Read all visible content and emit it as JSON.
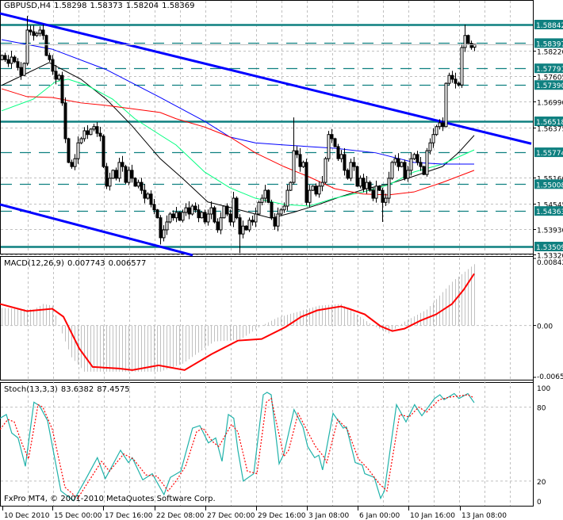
{
  "header": {
    "symbol": "GBPUSD,H4",
    "open": "1.58298",
    "high": "1.58373",
    "low": "1.58204",
    "close": "1.58369"
  },
  "copyright": "FxPro MT4, © 2001-2010 MetaQuotes Software Corp.",
  "colors": {
    "level": "#0f8080",
    "trend": "#0000ff",
    "ma_fast": "#000000",
    "ma_mid": "#00ff7f",
    "ma_slow": "#0000ff",
    "ma_long": "#ff0000",
    "macd_hist": "#c0c0c0",
    "macd_signal": "#ff0000",
    "stoch_main": "#20b2aa",
    "stoch_signal": "#ff0000",
    "grid": "#c0c0c0"
  },
  "chart_data": {
    "type": "candlestick",
    "title": "GBPUSD,H4",
    "price_axis_labels": [
      "1.58220",
      "1.57605",
      "1.56990",
      "1.56375",
      "1.55160",
      "1.54545",
      "1.53930",
      "1.53320"
    ],
    "levels": [
      {
        "label": "1.58842",
        "style": "solid"
      },
      {
        "label": "1.58397",
        "style": "dashed"
      },
      {
        "label": "1.57791",
        "style": "dashed"
      },
      {
        "label": "1.57390",
        "style": "dashed"
      },
      {
        "label": "1.56518",
        "style": "solid"
      },
      {
        "label": "1.55774",
        "style": "dashed"
      },
      {
        "label": "1.55008",
        "style": "dashed"
      },
      {
        "label": "1.54363",
        "style": "dashed"
      },
      {
        "label": "1.53509",
        "style": "solid"
      }
    ],
    "bid": 1.58369,
    "time_labels": [
      {
        "text": "10 Dec 2010",
        "bar": 0.25
      },
      {
        "text": "15 Dec 00:00",
        "bar": 16
      },
      {
        "text": "17 Dec 16:00",
        "bar": 32
      },
      {
        "text": "22 Dec 08:00",
        "bar": 48.25
      },
      {
        "text": "27 Dec 00:00",
        "bar": 64.25
      },
      {
        "text": "29 Dec 16:00",
        "bar": 80.25
      },
      {
        "text": "3 Jan 08:00",
        "bar": 96.25
      },
      {
        "text": "6 Jan 00:00",
        "bar": 112.25
      },
      {
        "text": "10 Jan 16:00",
        "bar": 128.25
      },
      {
        "text": "13 Jan 08:00",
        "bar": 144.5
      }
    ],
    "first_open": 1.58,
    "last_bar": {
      "open": 1.58298,
      "high": 1.58373,
      "low": 1.58204,
      "close": 1.58369
    },
    "high_overrides": {
      "8": 1.5905,
      "92": 1.5661,
      "146": 1.5884
    },
    "low_overrides": {
      "75": 1.5335,
      "50": 1.5356,
      "120": 1.541
    },
    "close": [
      1.581,
      1.58,
      1.5791,
      1.5806,
      1.5795,
      1.5781,
      1.5762,
      1.5791,
      1.5871,
      1.5867,
      1.5858,
      1.5863,
      1.5871,
      1.5858,
      1.581,
      1.58,
      1.5772,
      1.5753,
      1.5762,
      1.5696,
      1.561,
      1.5553,
      1.5543,
      1.5562,
      1.56,
      1.561,
      1.5629,
      1.562,
      1.5633,
      1.5639,
      1.5623,
      1.5616,
      1.5543,
      1.5496,
      1.5515,
      1.5534,
      1.5515,
      1.5553,
      1.5543,
      1.5505,
      1.5534,
      1.5515,
      1.5496,
      1.5505,
      1.5486,
      1.5467,
      1.5477,
      1.5452,
      1.5439,
      1.542,
      1.5372,
      1.5391,
      1.541,
      1.5429,
      1.542,
      1.5433,
      1.5414,
      1.5433,
      1.5444,
      1.5429,
      1.5448,
      1.5439,
      1.542,
      1.5433,
      1.541,
      1.5429,
      1.5444,
      1.541,
      1.5391,
      1.542,
      1.5448,
      1.5429,
      1.541,
      1.5467,
      1.542,
      1.5381,
      1.54,
      1.5391,
      1.5414,
      1.541,
      1.5429,
      1.5457,
      1.5467,
      1.5486,
      1.5457,
      1.542,
      1.54,
      1.5429,
      1.5439,
      1.5448,
      1.5486,
      1.5505,
      1.5581,
      1.5572,
      1.5543,
      1.5553,
      1.5457,
      1.5486,
      1.5496,
      1.5477,
      1.5496,
      1.5505,
      1.5562,
      1.562,
      1.561,
      1.5591,
      1.5562,
      1.5572,
      1.5534,
      1.5515,
      1.5553,
      1.5543,
      1.5496,
      1.5515,
      1.549,
      1.5505,
      1.5486,
      1.5467,
      1.5496,
      1.5486,
      1.5457,
      1.5467,
      1.5515,
      1.5553,
      1.5562,
      1.5543,
      1.5553,
      1.5515,
      1.5534,
      1.5562,
      1.5572,
      1.5553,
      1.5543,
      1.5524,
      1.5581,
      1.56,
      1.562,
      1.5639,
      1.5648,
      1.5639,
      1.5743,
      1.5762,
      1.5753,
      1.5743,
      1.5739,
      1.5829,
      1.5858,
      1.5839,
      1.5829,
      1.58369
    ],
    "moving_averages": [
      {
        "name": "ma_fast",
        "color_key": "ma_fast",
        "points": [
          [
            0,
            1.5738
          ],
          [
            15,
            1.5793
          ],
          [
            25,
            1.5753
          ],
          [
            33,
            1.5705
          ],
          [
            41,
            1.5642
          ],
          [
            50,
            1.5562
          ],
          [
            57,
            1.5515
          ],
          [
            65,
            1.5458
          ],
          [
            75,
            1.5439
          ],
          [
            85,
            1.5419
          ],
          [
            92,
            1.5433
          ],
          [
            100,
            1.5452
          ],
          [
            107,
            1.5471
          ],
          [
            115,
            1.549
          ],
          [
            122,
            1.5501
          ],
          [
            130,
            1.552
          ],
          [
            139,
            1.5543
          ],
          [
            144,
            1.5576
          ],
          [
            149,
            1.5618
          ]
        ]
      },
      {
        "name": "ma_mid",
        "color_key": "ma_mid",
        "points": [
          [
            0,
            1.5677
          ],
          [
            10,
            1.5705
          ],
          [
            17,
            1.5747
          ],
          [
            21,
            1.5753
          ],
          [
            27,
            1.5738
          ],
          [
            35,
            1.5705
          ],
          [
            42,
            1.5658
          ],
          [
            50,
            1.5619
          ],
          [
            55,
            1.5595
          ],
          [
            64,
            1.553
          ],
          [
            72,
            1.5492
          ],
          [
            80,
            1.5467
          ],
          [
            89,
            1.5452
          ],
          [
            97,
            1.5448
          ],
          [
            105,
            1.5467
          ],
          [
            114,
            1.5482
          ],
          [
            122,
            1.5499
          ],
          [
            130,
            1.553
          ],
          [
            139,
            1.5549
          ],
          [
            149,
            1.5583
          ]
        ]
      },
      {
        "name": "ma_slow",
        "color_key": "ma_slow",
        "points": [
          [
            0,
            1.5848
          ],
          [
            16,
            1.5825
          ],
          [
            33,
            1.5776
          ],
          [
            50,
            1.5709
          ],
          [
            64,
            1.5652
          ],
          [
            72,
            1.5614
          ],
          [
            80,
            1.56
          ],
          [
            89,
            1.5595
          ],
          [
            97,
            1.5591
          ],
          [
            105,
            1.5587
          ],
          [
            118,
            1.5576
          ],
          [
            130,
            1.5553
          ],
          [
            139,
            1.5549
          ],
          [
            149,
            1.5549
          ]
        ]
      },
      {
        "name": "ma_long",
        "color_key": "ma_long",
        "points": [
          [
            0,
            1.573
          ],
          [
            8,
            1.5711
          ],
          [
            16,
            1.5709
          ],
          [
            25,
            1.5696
          ],
          [
            33,
            1.569
          ],
          [
            41,
            1.5682
          ],
          [
            50,
            1.5673
          ],
          [
            55,
            1.5658
          ],
          [
            64,
            1.5638
          ],
          [
            72,
            1.5614
          ],
          [
            80,
            1.5576
          ],
          [
            89,
            1.5543
          ],
          [
            97,
            1.5518
          ],
          [
            105,
            1.549
          ],
          [
            114,
            1.5477
          ],
          [
            122,
            1.5475
          ],
          [
            130,
            1.5482
          ],
          [
            139,
            1.5505
          ],
          [
            149,
            1.5534
          ]
        ]
      }
    ],
    "trendlines": [
      {
        "name": "upper-channel",
        "points": [
          [
            -0.5,
            1.5911
          ],
          [
            167,
            1.5598
          ]
        ]
      },
      {
        "name": "lower-channel",
        "points": [
          [
            -0.5,
            1.5452
          ],
          [
            60.25,
            1.533
          ]
        ]
      }
    ],
    "macd": {
      "title": "MACD(12,26,9)",
      "main_value": "0.007743",
      "signal_value": "0.006577",
      "axis_labels": [
        "0.00842",
        "0.00",
        "-0.00651"
      ],
      "histogram": [
        [
          0,
          0.0022
        ],
        [
          10,
          0.002
        ],
        [
          13,
          0.0027
        ],
        [
          16,
          0.0025
        ],
        [
          18,
          0.0
        ],
        [
          22,
          -0.004
        ],
        [
          26,
          -0.0058
        ],
        [
          35,
          -0.0058
        ],
        [
          50,
          -0.0058
        ],
        [
          57,
          -0.0048
        ],
        [
          67,
          -0.002
        ],
        [
          75,
          -0.0018
        ],
        [
          82,
          0.0
        ],
        [
          87,
          0.001
        ],
        [
          100,
          0.0025
        ],
        [
          107,
          0.0027
        ],
        [
          117,
          0.0
        ],
        [
          122,
          -0.001
        ],
        [
          127,
          0.0005
        ],
        [
          134,
          0.002
        ],
        [
          142,
          0.0055
        ],
        [
          149,
          0.0077
        ]
      ],
      "signal": [
        [
          -0.5,
          0.0027
        ],
        [
          8,
          0.0018
        ],
        [
          16,
          0.0021
        ],
        [
          19.5,
          0.0011
        ],
        [
          24.5,
          -0.0029
        ],
        [
          28.7,
          -0.0052
        ],
        [
          37,
          -0.0054
        ],
        [
          41.2,
          -0.0056
        ],
        [
          49.5,
          -0.005
        ],
        [
          57.7,
          -0.0056
        ],
        [
          66.2,
          -0.0036
        ],
        [
          74.5,
          -0.0019
        ],
        [
          82,
          -0.0017
        ],
        [
          89.5,
          -0.0002
        ],
        [
          94.5,
          0.0011
        ],
        [
          99.5,
          0.0019
        ],
        [
          107,
          0.0024
        ],
        [
          109.5,
          0.0021
        ],
        [
          114.5,
          0.0014
        ],
        [
          119.5,
          -0.0001
        ],
        [
          123.2,
          -0.0007
        ],
        [
          127,
          -0.0004
        ],
        [
          132,
          0.0006
        ],
        [
          137,
          0.0014
        ],
        [
          142,
          0.0027
        ],
        [
          145.7,
          0.0045
        ],
        [
          149,
          0.0065
        ]
      ]
    },
    "stochastic": {
      "title": "Stoch(13,3,3)",
      "main_value": "83.6382",
      "signal_value": "87.4575",
      "axis_labels": [
        {
          "text": "100",
          "v": 100
        },
        {
          "text": "80",
          "v": 80
        },
        {
          "text": "20",
          "v": 20
        },
        {
          "text": "0",
          "v": 0
        }
      ],
      "main": [
        [
          -0.5,
          71
        ],
        [
          1.5,
          74
        ],
        [
          3.2,
          59
        ],
        [
          5.2,
          55
        ],
        [
          7.5,
          32
        ],
        [
          10.2,
          84
        ],
        [
          12,
          81
        ],
        [
          14.5,
          69
        ],
        [
          18.7,
          12
        ],
        [
          22.7,
          4
        ],
        [
          26.2,
          20
        ],
        [
          30.2,
          39
        ],
        [
          32.7,
          22
        ],
        [
          37.5,
          45
        ],
        [
          40,
          35
        ],
        [
          41.2,
          39
        ],
        [
          44.5,
          21
        ],
        [
          47.5,
          26
        ],
        [
          51.2,
          9
        ],
        [
          53.2,
          23
        ],
        [
          56.5,
          28
        ],
        [
          60.2,
          63
        ],
        [
          62.5,
          65
        ],
        [
          65.2,
          51
        ],
        [
          67.5,
          55
        ],
        [
          69.5,
          36
        ],
        [
          71.5,
          74
        ],
        [
          73.2,
          71
        ],
        [
          74.5,
          45
        ],
        [
          76.2,
          20
        ],
        [
          79.5,
          26
        ],
        [
          82.5,
          90
        ],
        [
          83.7,
          92
        ],
        [
          85,
          90
        ],
        [
          87.5,
          34
        ],
        [
          89,
          42
        ],
        [
          92.2,
          78
        ],
        [
          95,
          64
        ],
        [
          96.5,
          48
        ],
        [
          98.7,
          39
        ],
        [
          100,
          41
        ],
        [
          101.2,
          29
        ],
        [
          104.5,
          75
        ],
        [
          107.7,
          63
        ],
        [
          108.7,
          64
        ],
        [
          111.5,
          35
        ],
        [
          113.7,
          33
        ],
        [
          114.5,
          26
        ],
        [
          117.5,
          23
        ],
        [
          119.5,
          6
        ],
        [
          120.7,
          12
        ],
        [
          124.5,
          82
        ],
        [
          127.5,
          68
        ],
        [
          130.2,
          82
        ],
        [
          132.5,
          73
        ],
        [
          136.5,
          87
        ],
        [
          138.2,
          90
        ],
        [
          139.5,
          86
        ],
        [
          142.7,
          91
        ],
        [
          144.2,
          87
        ],
        [
          147,
          91
        ],
        [
          149,
          83.6
        ]
      ],
      "signal": [
        [
          -0.5,
          62
        ],
        [
          2,
          70
        ],
        [
          4,
          68
        ],
        [
          6.5,
          50
        ],
        [
          8.5,
          38
        ],
        [
          11.5,
          82
        ],
        [
          13,
          80
        ],
        [
          16,
          62
        ],
        [
          20,
          15
        ],
        [
          24,
          6
        ],
        [
          28,
          22
        ],
        [
          31.5,
          36
        ],
        [
          34,
          28
        ],
        [
          38.5,
          42
        ],
        [
          41.5,
          38
        ],
        [
          45.5,
          25
        ],
        [
          49,
          24
        ],
        [
          52.5,
          12
        ],
        [
          55,
          20
        ],
        [
          58,
          32
        ],
        [
          61.5,
          60
        ],
        [
          63.5,
          63
        ],
        [
          66.5,
          52
        ],
        [
          68.5,
          48
        ],
        [
          72.5,
          66
        ],
        [
          74.5,
          60
        ],
        [
          77.5,
          28
        ],
        [
          80.5,
          26
        ],
        [
          83.5,
          84
        ],
        [
          85,
          87
        ],
        [
          89,
          40
        ],
        [
          90.5,
          45
        ],
        [
          93.5,
          75
        ],
        [
          96.5,
          60
        ],
        [
          99,
          48
        ],
        [
          101.5,
          40
        ],
        [
          102.5,
          35
        ],
        [
          106,
          70
        ],
        [
          109,
          62
        ],
        [
          112.5,
          38
        ],
        [
          115.5,
          30
        ],
        [
          119,
          18
        ],
        [
          121.5,
          12
        ],
        [
          125.5,
          74
        ],
        [
          128.5,
          72
        ],
        [
          131.5,
          80
        ],
        [
          134,
          76
        ],
        [
          138,
          86
        ],
        [
          141,
          88
        ],
        [
          144,
          89
        ],
        [
          147,
          90
        ],
        [
          149,
          87.5
        ]
      ]
    }
  }
}
